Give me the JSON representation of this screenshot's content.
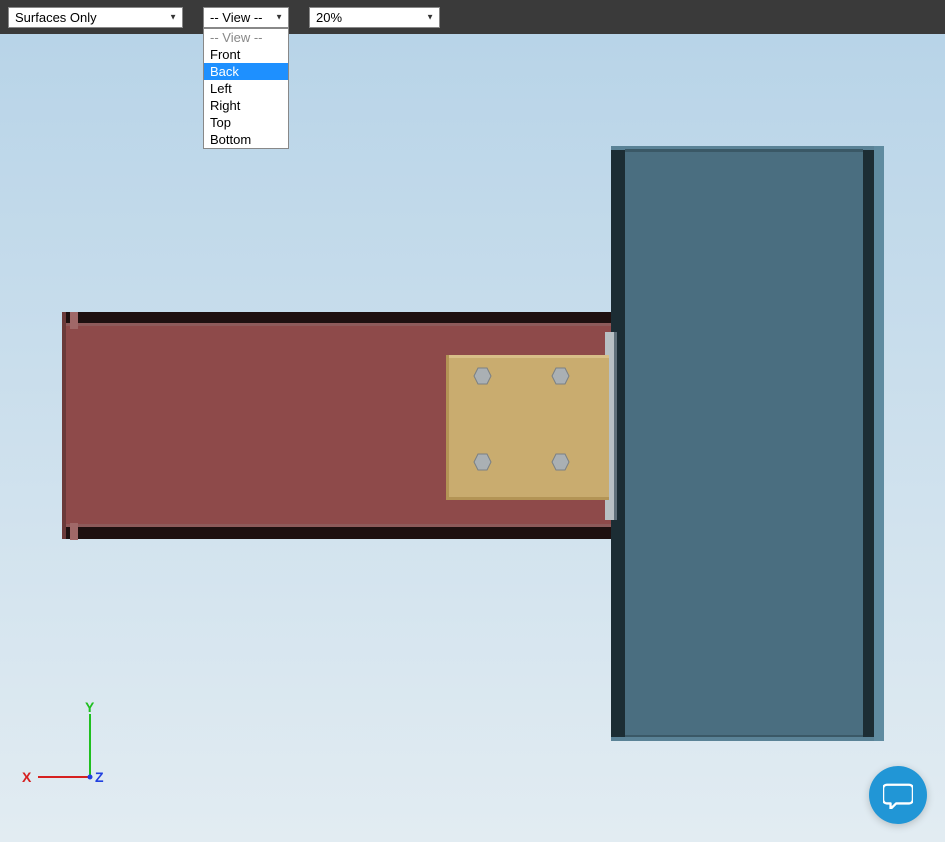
{
  "toolbar": {
    "surfaces_select": "Surfaces Only",
    "view_select": "-- View --",
    "zoom_select": "20%"
  },
  "view_dropdown": {
    "placeholder": "-- View --",
    "options": [
      "Front",
      "Back",
      "Left",
      "Right",
      "Top",
      "Bottom"
    ],
    "highlighted": "Back"
  },
  "axis": {
    "x_label": "X",
    "y_label": "Y",
    "z_label": "Z"
  }
}
